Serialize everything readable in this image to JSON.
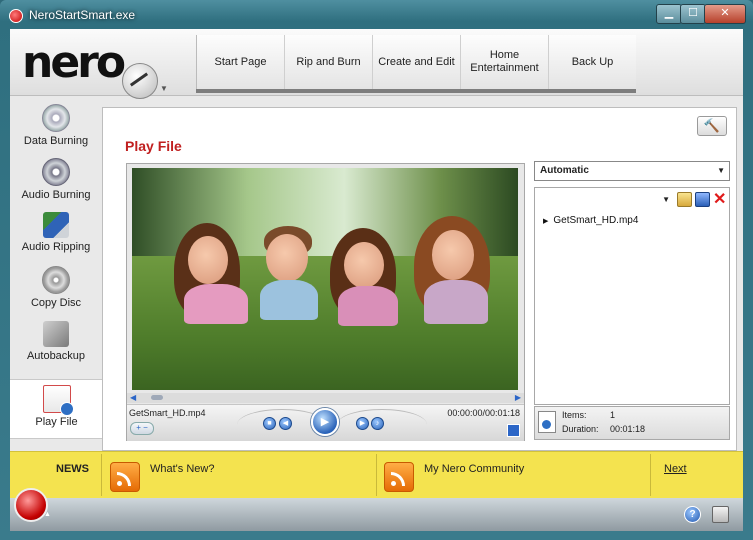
{
  "window": {
    "title": "NeroStartSmart.exe",
    "min": "▁",
    "max": "☐",
    "close": "✕"
  },
  "logo": {
    "text": "nero"
  },
  "nav": [
    {
      "label": "Start Page"
    },
    {
      "label": "Rip and Burn"
    },
    {
      "label": "Create and Edit"
    },
    {
      "label": "Home Entertainment"
    },
    {
      "label": "Back Up"
    }
  ],
  "sidebar": {
    "items": [
      {
        "label": "Data Burning",
        "icon": "data-disc-icon"
      },
      {
        "label": "Audio Burning",
        "icon": "audio-disc-icon"
      },
      {
        "label": "Audio Ripping",
        "icon": "audio-ripping-icon"
      },
      {
        "label": "Copy Disc",
        "icon": "copy-disc-icon"
      },
      {
        "label": "Autobackup",
        "icon": "autobackup-icon"
      },
      {
        "label": "Play File",
        "icon": "play-file-icon",
        "active": true
      }
    ]
  },
  "panel": {
    "title": "Play File",
    "tool_icon": "🔨"
  },
  "player": {
    "file_name": "GetSmart_HD.mp4",
    "time": "00:00:00/00:01:18",
    "zoom": "+ −",
    "play": "▶"
  },
  "output_select": {
    "value": "Automatic"
  },
  "playlist": {
    "items": [
      {
        "label": "GetSmart_HD.mp4"
      }
    ],
    "delete_icon": "✕"
  },
  "info": {
    "items_label": "Items:",
    "items_value": "1",
    "duration_label": "Duration:",
    "duration_value": "00:01:18"
  },
  "news": {
    "label": "NEWS",
    "links": [
      {
        "label": "What's New?"
      },
      {
        "label": "My Nero Community"
      }
    ],
    "next": "Next"
  },
  "bottombar": {
    "help": "?"
  },
  "colors": {
    "accent_red": "#c01f1f",
    "news_yellow": "#f4e34f",
    "window_teal": "#3a7b8c"
  }
}
